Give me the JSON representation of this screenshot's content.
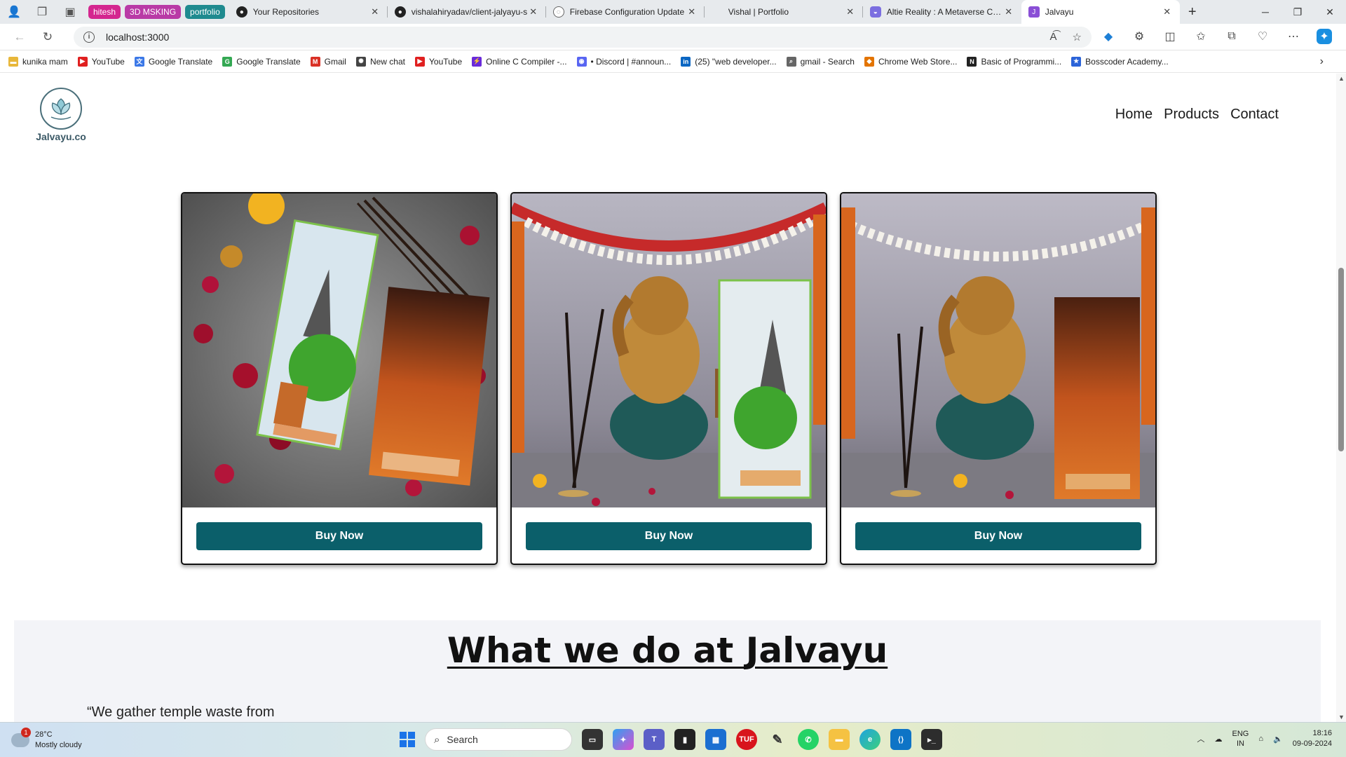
{
  "browser": {
    "tab_groups": [
      {
        "label": "hitesh",
        "color": "#d4268f"
      },
      {
        "label": "3D MSKING",
        "color": "#b93aa6"
      },
      {
        "label": "portfolio",
        "color": "#1f8a8f"
      }
    ],
    "tabs": [
      {
        "label": "Your Repositories",
        "icon": "github-icon"
      },
      {
        "label": "vishalahiryadav/client-jalyayu-s",
        "icon": "github-icon"
      },
      {
        "label": "Firebase Configuration Update",
        "icon": "globe-icon"
      },
      {
        "label": "Vishal | Portfolio",
        "icon": "blank-icon"
      },
      {
        "label": "Altie Reality : A Metaverse Com",
        "icon": "altie-icon"
      },
      {
        "label": "Jalvayu",
        "icon": "jalvayu-icon",
        "active": true
      }
    ],
    "url": "localhost:3000",
    "bookmarks": [
      {
        "label": "kunika mam",
        "icon": "folder-icon",
        "color": "#e8b73a"
      },
      {
        "label": "YouTube",
        "icon": "youtube-icon",
        "color": "#e02020"
      },
      {
        "label": "Google Translate",
        "icon": "translate-icon",
        "color": "#3b78e7"
      },
      {
        "label": "Google Translate",
        "icon": "google-icon",
        "color": "#34a853"
      },
      {
        "label": "Gmail",
        "icon": "gmail-icon",
        "color": "#d93025"
      },
      {
        "label": "New chat",
        "icon": "openai-icon",
        "color": "#444444"
      },
      {
        "label": "YouTube",
        "icon": "youtube-icon",
        "color": "#e02020"
      },
      {
        "label": "Online C Compiler -...",
        "icon": "compiler-icon",
        "color": "#6a2bd9"
      },
      {
        "label": "• Discord | #announ...",
        "icon": "discord-icon",
        "color": "#5865f2"
      },
      {
        "label": "(25) \"web developer...",
        "icon": "linkedin-icon",
        "color": "#0a66c2"
      },
      {
        "label": "gmail - Search",
        "icon": "search-icon",
        "color": "#666666"
      },
      {
        "label": "Chrome Web Store...",
        "icon": "webstore-icon",
        "color": "#e37400"
      },
      {
        "label": "Basic of Programmi...",
        "icon": "notion-icon",
        "color": "#222222"
      },
      {
        "label": "Bosscoder Academy...",
        "icon": "bosscoder-icon",
        "color": "#2b63d8"
      }
    ]
  },
  "site": {
    "logo_text": "Jalvayu.co",
    "nav": [
      "Home",
      "Products",
      "Contact"
    ],
    "products": [
      {
        "button": "Buy Now",
        "image": "incense-packs-with-flowers"
      },
      {
        "button": "Buy Now",
        "image": "ganesha-idol-with-mogra-pack"
      },
      {
        "button": "Buy Now",
        "image": "ganesha-idol-with-chandan-pack"
      }
    ],
    "about": {
      "title_prefix": "What we do at ",
      "title_brand": "Jalvayu",
      "quote": "“We gather temple waste from"
    }
  },
  "taskbar": {
    "temperature": "28°C",
    "weather": "Mostly cloudy",
    "weather_badge": "1",
    "search_placeholder": "Search",
    "lang_line1": "ENG",
    "lang_line2": "IN",
    "time": "18:16",
    "date": "09-09-2024"
  },
  "colors": {
    "accent": "#0b5f6a",
    "tab_bar": "#e7eaed"
  }
}
